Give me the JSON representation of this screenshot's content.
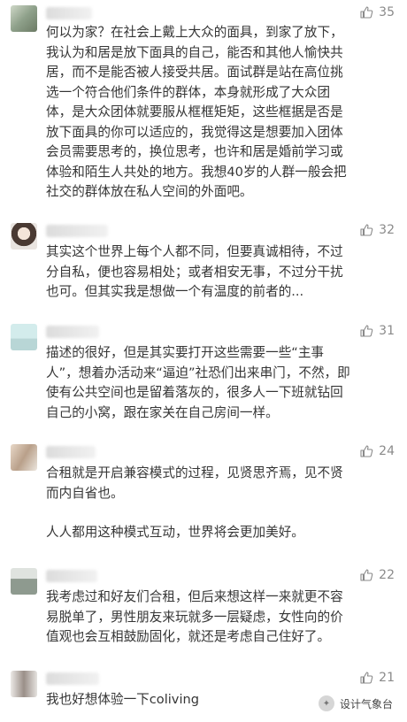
{
  "comments": [
    {
      "likes": "35",
      "lines": [
        "何以为家？在社会上戴上大众的面具，到家了放下，",
        "我认为和居是放下面具的自己，能否和其他人愉快共",
        "居，而不是能否被人接受共居。面试群是站在高位挑",
        "选一个符合他们条件的群体，本身就形成了大众团",
        "体，是大众团体就要服从框框矩矩，这些框据是否是",
        "放下面具的你可以适应的，我觉得这是想要加入团体",
        "会员需要思考的，换位思考，也许和居是婚前学习或",
        "体验和陌生人共处的地方。我想40岁的人群一般会把",
        "社交的群体放在私人空间的外面吧。"
      ]
    },
    {
      "likes": "32",
      "lines": [
        "其实这个世界上每个人都不同，但要真诚相待，不过",
        "分自私，便也容易相处；或者相安无事，不过分干扰",
        "也可。但其实我是想做一个有温度的前者的..."
      ]
    },
    {
      "likes": "31",
      "lines": [
        "描述的很好，但是其实要打开这些需要一些“主事",
        "人”，想着办活动来“逼迫”社恐们出来串门，不然，即",
        "使有公共空间也是留着落灰的，很多人一下班就钻回",
        "自己的小窝，跟在家关在自己房间一样。"
      ]
    },
    {
      "likes": "24",
      "lines": [
        "合租就是开启兼容模式的过程，见贤思齐焉，见不贤",
        "而内自省也。"
      ],
      "lines2": [
        "人人都用这种模式互动，世界将会更加美好。"
      ]
    },
    {
      "likes": "22",
      "lines": [
        "我考虑过和好友们合租，但后来想这样一来就更不容",
        "易脱单了，男性朋友来玩就多一层疑虑，女性向的价",
        "值观也会互相鼓励固化，就还是考虑自己住好了。"
      ]
    },
    {
      "likes": "21",
      "lines": [
        "我也好想体验一下coliving"
      ]
    }
  ],
  "watermark": {
    "text": "设计气象台"
  },
  "icons": {
    "like": "thumbs-up-icon"
  },
  "colors": {
    "text": "#353535",
    "meta": "#8a8a8a"
  }
}
